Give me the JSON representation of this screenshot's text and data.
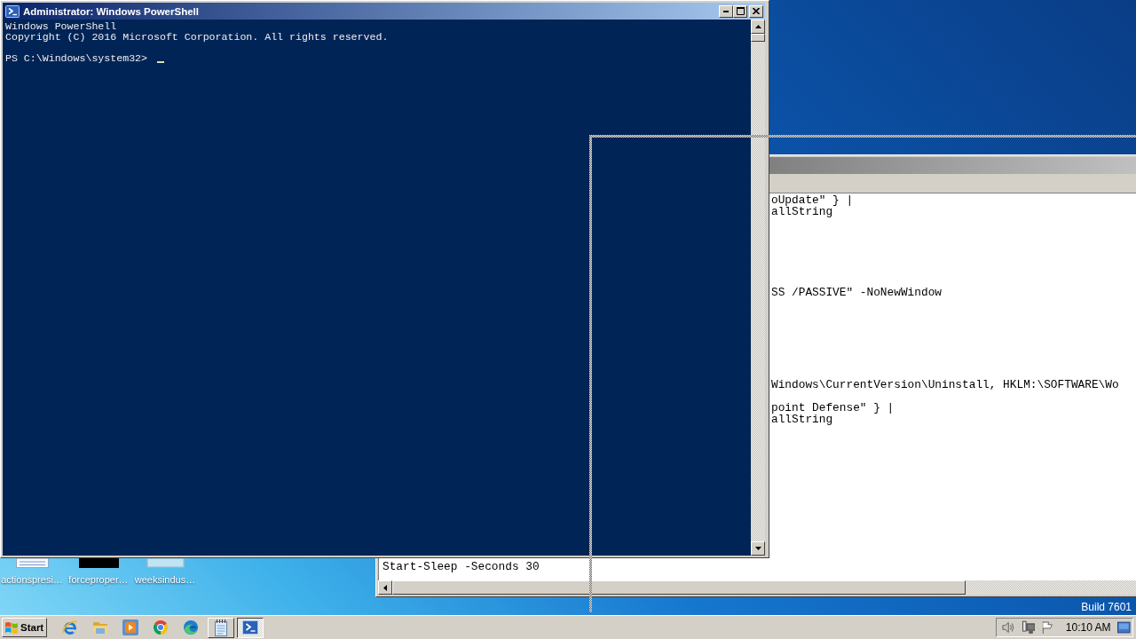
{
  "powershell_window": {
    "title": "Administrator: Windows PowerShell",
    "active": true,
    "banner": [
      "Windows PowerShell",
      "Copyright (C) 2016 Microsoft Corporation. All rights reserved."
    ],
    "prompt": "PS C:\\Windows\\system32>"
  },
  "notepad_window": {
    "active": false,
    "lines": [
      "oUpdate\" } |",
      "allString",
      "SS /PASSIVE\" -NoNewWindow",
      "Windows\\CurrentVersion\\Uninstall, HKLM:\\SOFTWARE\\Wo",
      "point Defense\" } |",
      "allString"
    ],
    "last_line": "Start-Sleep -Seconds 30"
  },
  "desktop": {
    "icons": [
      {
        "kind": "document",
        "label": "actionspresi…"
      },
      {
        "kind": "image",
        "label": "forceproper…"
      },
      {
        "kind": "blank",
        "label": "weeksindus…"
      }
    ],
    "build": "Build 7601"
  },
  "taskbar": {
    "start": "Start",
    "tasks": [
      {
        "kind": "notepad",
        "selected": false
      },
      {
        "kind": "powershell",
        "selected": true
      }
    ],
    "clock": "10:10 AM"
  }
}
